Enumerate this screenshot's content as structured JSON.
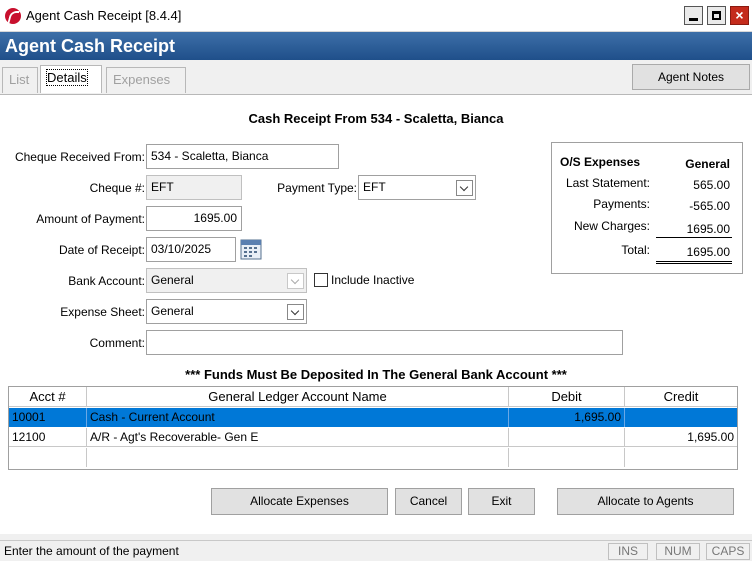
{
  "window": {
    "title": "Agent Cash Receipt [8.4.4]"
  },
  "header": {
    "title": "Agent Cash Receipt"
  },
  "tabs": [
    {
      "label": "List",
      "state": "disabled"
    },
    {
      "label": "Details",
      "state": "active"
    },
    {
      "label": "Expenses",
      "state": "disabled"
    }
  ],
  "toolbar": {
    "agent_notes_label": "Agent Notes"
  },
  "form": {
    "heading": "Cash Receipt From 534 - Scaletta, Bianca",
    "cheque_from_label": "Cheque Received From:",
    "cheque_from_value": "534 - Scaletta, Bianca",
    "cheque_no_label": "Cheque #:",
    "cheque_no_value": "EFT",
    "payment_type_label": "Payment Type:",
    "payment_type_value": "EFT",
    "amount_label": "Amount of Payment:",
    "amount_value": "1695.00",
    "date_label": "Date of Receipt:",
    "date_value": "03/10/2025",
    "bank_label": "Bank Account:",
    "bank_value": "General",
    "include_inactive_label": "Include Inactive",
    "expense_sheet_label": "Expense Sheet:",
    "expense_sheet_value": "General",
    "comment_label": "Comment:",
    "comment_value": "",
    "notice": "*** Funds Must Be Deposited In The General Bank Account ***"
  },
  "os_expenses": {
    "title": "O/S Expenses",
    "column": "General",
    "rows": [
      {
        "label": "Last Statement:",
        "value": "565.00"
      },
      {
        "label": "Payments:",
        "value": "-565.00"
      },
      {
        "label": "New Charges:",
        "value": "1695.00"
      }
    ],
    "total_label": "Total:",
    "total_value": "1695.00"
  },
  "table": {
    "headers": [
      "Acct #",
      "General Ledger Account Name",
      "Debit",
      "Credit"
    ],
    "rows": [
      {
        "acct": "10001",
        "name": "Cash - Current Account",
        "debit": "1,695.00",
        "credit": ""
      },
      {
        "acct": "12100",
        "name": "A/R - Agt's Recoverable- Gen E",
        "debit": "",
        "credit": "1,695.00"
      }
    ]
  },
  "buttons": {
    "allocate_expenses": "Allocate Expenses",
    "cancel": "Cancel",
    "exit": "Exit",
    "allocate_agents": "Allocate to Agents"
  },
  "status": {
    "message": "Enter the amount of the payment",
    "ins": "INS",
    "num": "NUM",
    "caps": "CAPS"
  },
  "colors": {
    "header_band": "#1f4f8a",
    "selection": "#0078d7",
    "close_button": "#c42b1c"
  }
}
